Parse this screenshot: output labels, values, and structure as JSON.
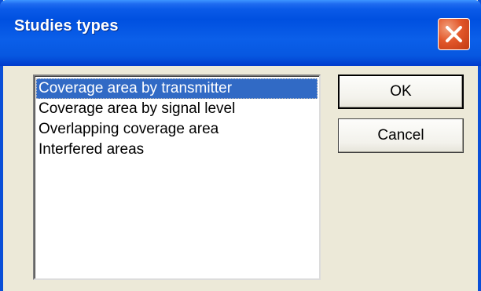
{
  "window": {
    "title": "Studies types",
    "close_icon": "close-icon"
  },
  "list": {
    "items": [
      "Coverage area by transmitter",
      "Coverage area by signal level",
      "Overlapping coverage area",
      "Interfered areas"
    ],
    "selected": "Coverage area by transmitter"
  },
  "buttons": {
    "ok_label": "OK",
    "cancel_label": "Cancel"
  },
  "colors": {
    "titlebar": "#0050e0",
    "selection": "#316ac5",
    "dialog_bg": "#ece9d8"
  }
}
